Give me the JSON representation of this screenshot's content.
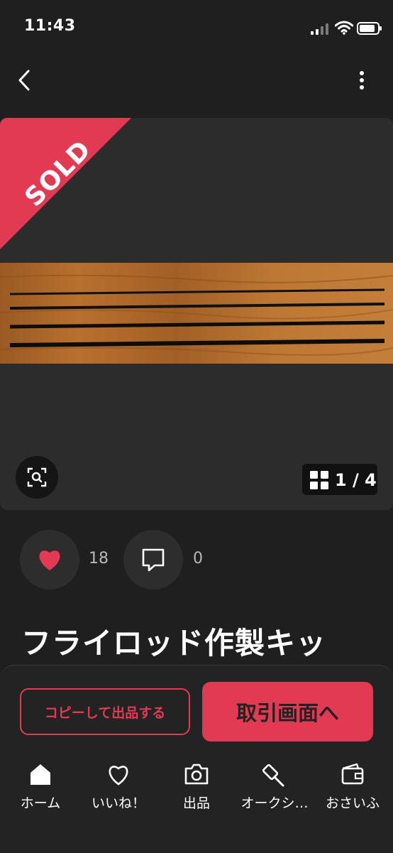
{
  "status_bar": {
    "time": "11:43"
  },
  "product": {
    "sold_label": "SOLD",
    "image_counter": "1 / 4",
    "title": "フライロッド作製キッ",
    "likes": "18",
    "comments": "0"
  },
  "actions": {
    "copy_listing_label": "コピーして出品する",
    "trade_screen_label": "取引画面へ"
  },
  "tabbar": {
    "home": "ホーム",
    "likes": "いいね！",
    "sell": "出品",
    "auction": "オークシ…",
    "wallet": "おさいふ"
  },
  "colors": {
    "accent": "#e23a52",
    "background": "#1f1f1f",
    "surface": "#2c2c2c"
  }
}
